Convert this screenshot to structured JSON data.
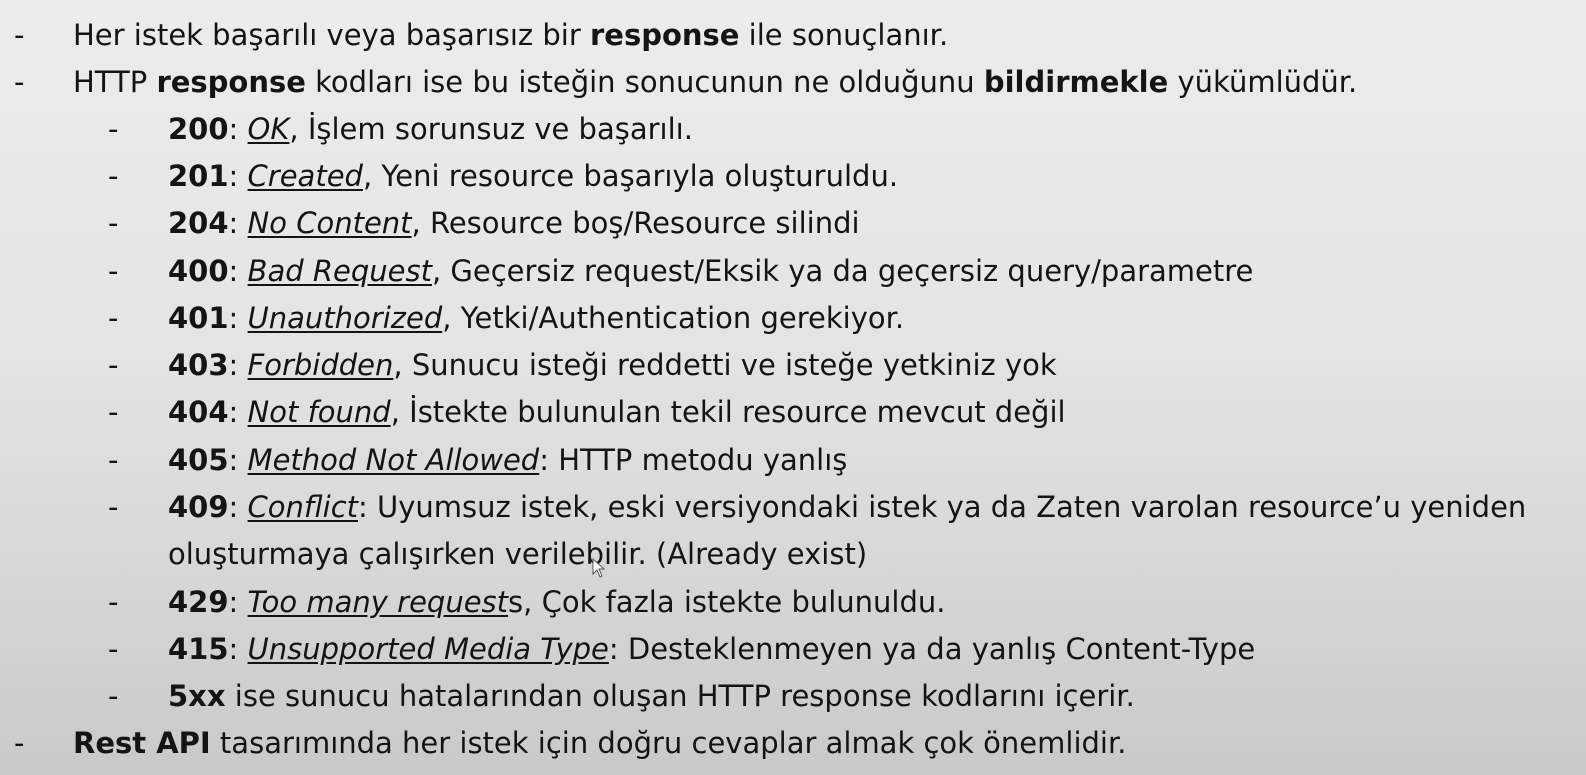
{
  "bullet": "-",
  "intro": [
    {
      "p1": "Her istek başarılı veya başarısız bir ",
      "b1": "response",
      "p2": " ile sonuçlanır."
    },
    {
      "p1": "HTTP ",
      "b1": "response",
      "p2": " kodları ise bu isteğin sonucunun ne olduğunu ",
      "b2": "bildirmekle",
      "p3": " yükümlüdür."
    }
  ],
  "codes": [
    {
      "code": "200",
      "sep": ": ",
      "term": "OK",
      "desc": ", İşlem sorunsuz ve başarılı."
    },
    {
      "code": "201",
      "sep": ": ",
      "term": "Created",
      "desc": ", Yeni resource başarıyla oluşturuldu."
    },
    {
      "code": "204",
      "sep": ": ",
      "term": "No Content",
      "desc": ", Resource boş/Resource silindi"
    },
    {
      "code": "400",
      "sep": ": ",
      "term": "Bad Request",
      "desc": ", Geçersiz request/Eksik ya da geçersiz query/parametre"
    },
    {
      "code": "401",
      "sep": ": ",
      "term": "Unauthorized",
      "desc": ", Yetki/Authentication gerekiyor."
    },
    {
      "code": "403",
      "sep": ": ",
      "term": "Forbidden",
      "desc": ", Sunucu isteği reddetti ve isteğe yetkiniz yok"
    },
    {
      "code": "404",
      "sep": ": ",
      "term": "Not found",
      "desc": ", İstekte bulunulan tekil resource mevcut değil"
    },
    {
      "code": "405",
      "sep": ": ",
      "term": "Method Not Allowed",
      "desc": ": HTTP metodu yanlış"
    },
    {
      "code": "409",
      "sep": ": ",
      "term": "Conflict",
      "desc": ": Uyumsuz istek, eski versiyondaki istek ya da Zaten varolan resource’u yeniden",
      "cont": "oluşturmaya çalışırken verilebilir. (Already exist)"
    },
    {
      "code": "429",
      "sep": ": ",
      "term": "Too many request",
      "desc": "s, Çok fazla istekte bulunuldu."
    },
    {
      "code": "415",
      "sep": ": ",
      "term": "Unsupported Media Type",
      "desc": ": Desteklenmeyen ya da yanlış Content-Type"
    }
  ],
  "fivexx": {
    "code": "5xx",
    "desc": " ise sunucu hatalarından oluşan HTTP response kodlarını içerir."
  },
  "outro": {
    "b1": "Rest API",
    "p1": " tasarımında her istek için doğru cevaplar almak çok önemlidir."
  }
}
